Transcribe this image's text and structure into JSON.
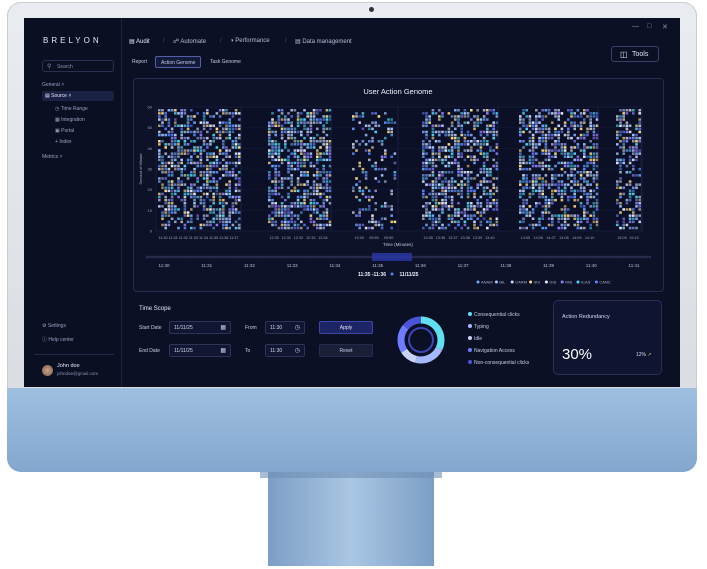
{
  "app": {
    "brand": "BRELYON"
  },
  "sidebar": {
    "search_placeholder": "Search",
    "general_label": "General",
    "source_label": "Source",
    "items": [
      {
        "label": "Time Range",
        "icon": "clock-icon"
      },
      {
        "label": "Integration",
        "icon": "grid-icon"
      },
      {
        "label": "Portal",
        "icon": "portal-icon"
      },
      {
        "label": "Index",
        "icon": "plus-icon"
      }
    ],
    "metrics_label": "Metrics",
    "settings_label": "Settings",
    "help_label": "Help center",
    "user": {
      "name": "John doe",
      "email": "johndoe@gmail.com"
    }
  },
  "topnav": {
    "items": [
      "Audit",
      "Automate",
      "Performance",
      "Data management"
    ],
    "separator": "/",
    "tools_label": "Tools"
  },
  "subtabs": [
    "Report",
    "Action Genome",
    "Task Genome"
  ],
  "subtab_active": 1,
  "chart_data": {
    "type": "heatmap",
    "title": "User Action Genome",
    "xlabel": "Time (Minutes)",
    "ylabel": "Second of Minute",
    "ylim": [
      0,
      60
    ],
    "y_ticks": [
      0,
      10,
      20,
      30,
      40,
      50,
      60
    ],
    "groups": [
      {
        "ticks": [
          "11:30",
          "11:31",
          "11:32",
          "11:33",
          "11:34",
          "11:35",
          "11:36",
          "11:37"
        ],
        "density": 0.55
      },
      {
        "ticks": [
          "12:30",
          "12:31",
          "12:32",
          "12:33",
          "12:34"
        ],
        "density": 0.6
      },
      {
        "ticks": [
          "10:00",
          "09:55",
          "09:50"
        ],
        "density": 0.25
      },
      {
        "ticks": [
          "13:35",
          "13:36",
          "13:37",
          "13:38",
          "13:39",
          "13:40"
        ],
        "density": 0.55
      },
      {
        "ticks": [
          "14:05",
          "14:06",
          "14:07",
          "14:08",
          "14:09",
          "14:10"
        ],
        "density": 0.55
      },
      {
        "ticks": [
          "15:09",
          "15:10"
        ],
        "density": 0.5
      }
    ],
    "legend": [
      {
        "name": "ANAM",
        "color": "#6fa8ff"
      },
      {
        "name": "BIL",
        "color": "#a8c8ff"
      },
      {
        "name": "CARM",
        "color": "#c8d4ff"
      },
      {
        "name": "SIS",
        "color": "#ffe08a"
      },
      {
        "name": "GIS",
        "color": "#e7ecf8"
      },
      {
        "name": "MIS",
        "color": "#8d7cff"
      },
      {
        "name": "ICAS",
        "color": "#49d7f2"
      },
      {
        "name": "CANC",
        "color": "#5a86ff"
      }
    ]
  },
  "timeline": {
    "ticks": [
      "11:30",
      "11:31",
      "11:32",
      "11:33",
      "11:34",
      "11:35",
      "11:36",
      "11:37",
      "11:38",
      "11:39",
      "11:40",
      "11:41"
    ],
    "selection_label": "11:35 -11:36",
    "selection_date": "11/11/25"
  },
  "time_scope": {
    "title": "Time Scope",
    "start_date_label": "Start Date",
    "start_date_value": "11/11/25",
    "end_date_label": "End Date",
    "end_date_value": "11/11/25",
    "from_label": "From",
    "from_value": "11:30",
    "to_label": "To",
    "to_value": "11:30",
    "apply_label": "Apply",
    "reset_label": "Reset"
  },
  "donut": {
    "legend": [
      {
        "label": "Consequential clicks",
        "color": "#5fe0f0"
      },
      {
        "label": "Typing",
        "color": "#a5b8ff"
      },
      {
        "label": "Idle",
        "color": "#c8d2f4"
      },
      {
        "label": "Navigation Access",
        "color": "#6f7cff"
      },
      {
        "label": "Non-consequential clicks",
        "color": "#4a54d8"
      }
    ],
    "values": [
      0.32,
      0.22,
      0.12,
      0.2,
      0.14
    ]
  },
  "redundancy": {
    "title": "Action Redundancy",
    "value": "30%",
    "change": "12%",
    "change_color": "#f2c14a"
  }
}
